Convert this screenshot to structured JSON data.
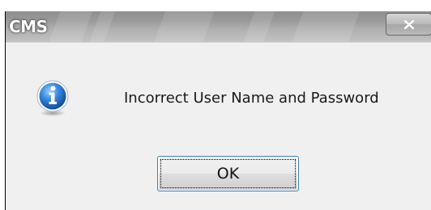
{
  "dialog": {
    "title": "CMS",
    "message": "Incorrect User Name and Password",
    "icon": "info-icon",
    "close_icon": "close-icon"
  },
  "buttons": {
    "ok_label": "OK"
  },
  "colors": {
    "titlebar": "#9e9e9e",
    "client_background": "#f0f0f0",
    "info_blue": "#1f6fc9",
    "button_focus_border": "#3c7fb1"
  }
}
